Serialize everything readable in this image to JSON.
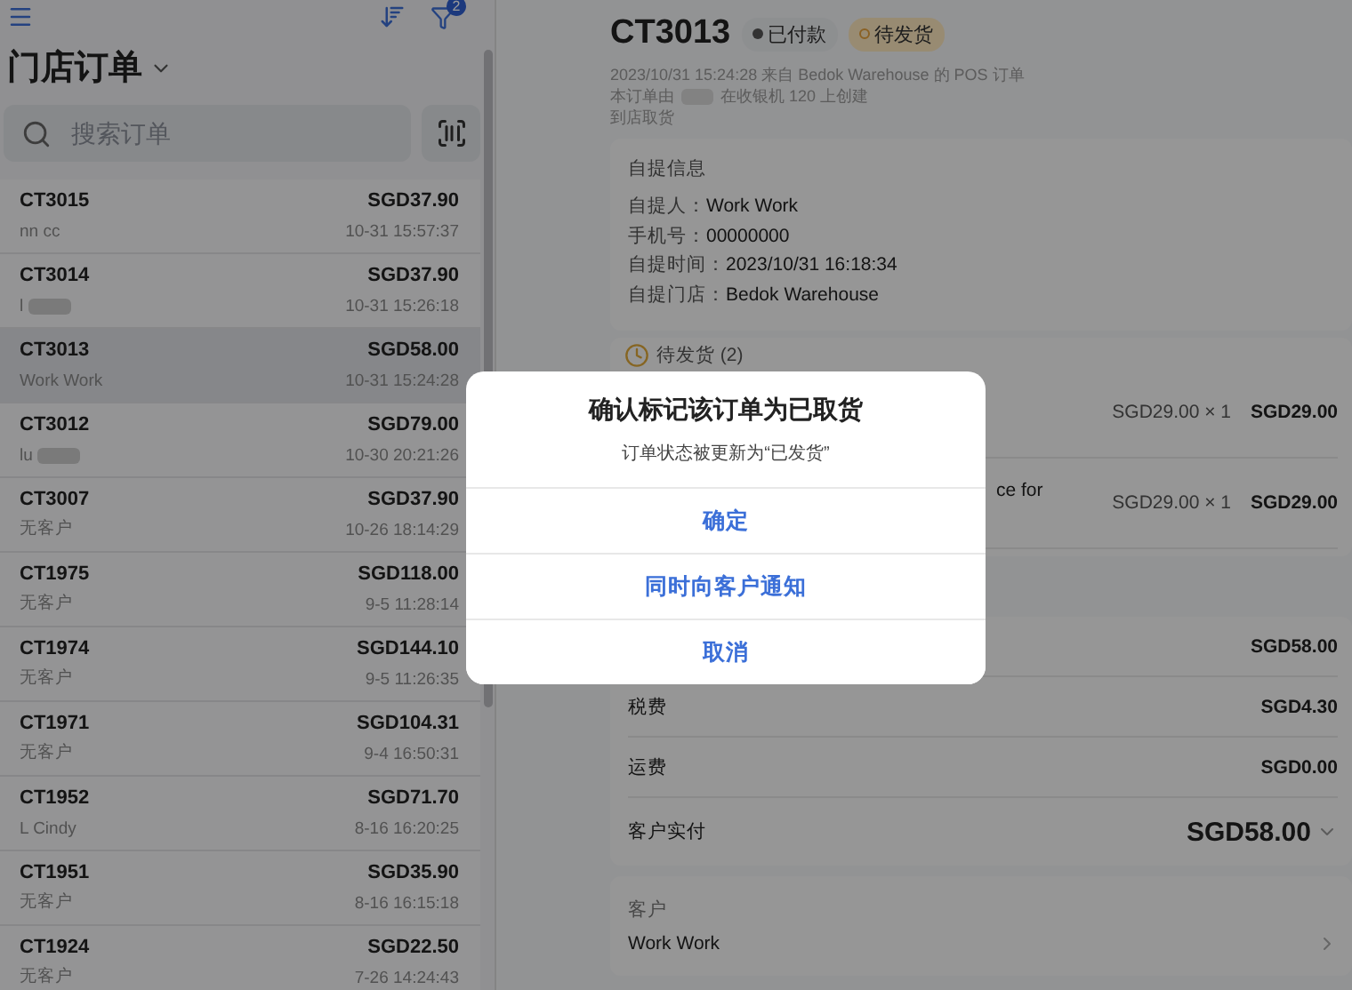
{
  "sidebar": {
    "title": "门店订单",
    "filter_count": "2",
    "search": {
      "placeholder": "搜索订单"
    },
    "orders": [
      {
        "id": "CT3015",
        "customer": "nn cc",
        "amount": "SGD37.90",
        "time": "10-31 15:57:37",
        "selected": false,
        "redacted": false
      },
      {
        "id": "CT3014",
        "customer": "l",
        "amount": "SGD37.90",
        "time": "10-31 15:26:18",
        "selected": false,
        "redacted": true
      },
      {
        "id": "CT3013",
        "customer": "Work Work",
        "amount": "SGD58.00",
        "time": "10-31 15:24:28",
        "selected": true,
        "redacted": false
      },
      {
        "id": "CT3012",
        "customer": "lu",
        "amount": "SGD79.00",
        "time": "10-30 20:21:26",
        "selected": false,
        "redacted": true
      },
      {
        "id": "CT3007",
        "customer": "无客户",
        "amount": "SGD37.90",
        "time": "10-26 18:14:29",
        "selected": false,
        "redacted": false
      },
      {
        "id": "CT1975",
        "customer": "无客户",
        "amount": "SGD118.00",
        "time": "9-5 11:28:14",
        "selected": false,
        "redacted": false
      },
      {
        "id": "CT1974",
        "customer": "无客户",
        "amount": "SGD144.10",
        "time": "9-5 11:26:35",
        "selected": false,
        "redacted": false
      },
      {
        "id": "CT1971",
        "customer": "无客户",
        "amount": "SGD104.31",
        "time": "9-4 16:50:31",
        "selected": false,
        "redacted": false
      },
      {
        "id": "CT1952",
        "customer": "L Cindy",
        "amount": "SGD71.70",
        "time": "8-16 16:20:25",
        "selected": false,
        "redacted": false
      },
      {
        "id": "CT1951",
        "customer": "无客户",
        "amount": "SGD35.90",
        "time": "8-16 16:15:18",
        "selected": false,
        "redacted": false
      },
      {
        "id": "CT1924",
        "customer": "无客户",
        "amount": "SGD22.50",
        "time": "7-26 14:24:43",
        "selected": false,
        "redacted": false
      }
    ]
  },
  "detail": {
    "order_id": "CT3013",
    "badges": [
      {
        "label": "已付款",
        "kind": "paid"
      },
      {
        "label": "待发货",
        "kind": "pending"
      }
    ],
    "meta": [
      "2023/10/31 15:24:28 来自 Bedok Warehouse 的 POS 订单"
    ],
    "creator": {
      "before": "本订单由",
      "after": "在收银机 120 上创建"
    },
    "fulfillment": "到店取货",
    "pickup": {
      "title": "自提信息",
      "fields": [
        {
          "label": "自提人：",
          "value": "Work Work"
        },
        {
          "label": "手机号：",
          "value": "00000000"
        },
        {
          "label": "自提时间：",
          "value": "2023/10/31 16:18:34"
        },
        {
          "label": "自提门店：",
          "value": "Bedok Warehouse"
        }
      ]
    },
    "pending": {
      "title": "待发货 (2)",
      "items": [
        {
          "price": "SGD29.00 × 1",
          "total": "SGD29.00"
        },
        {
          "name": "ce for",
          "price": "SGD29.00 × 1",
          "total": "SGD29.00"
        }
      ]
    },
    "summary": [
      {
        "value": "SGD58.00",
        "kind": "line"
      },
      {
        "label": "税费",
        "value": "SGD4.30",
        "kind": "line"
      },
      {
        "label": "运费",
        "value": "SGD0.00",
        "kind": "line"
      },
      {
        "label": "客户实付",
        "value": "SGD58.00",
        "kind": "total"
      }
    ],
    "customer": {
      "title": "客户",
      "name": "Work Work"
    }
  },
  "dialog": {
    "title": "确认标记该订单为已取货",
    "message": "订单状态被更新为“已发货”",
    "buttons": [
      "确定",
      "同时向客户通知",
      "取消"
    ]
  }
}
